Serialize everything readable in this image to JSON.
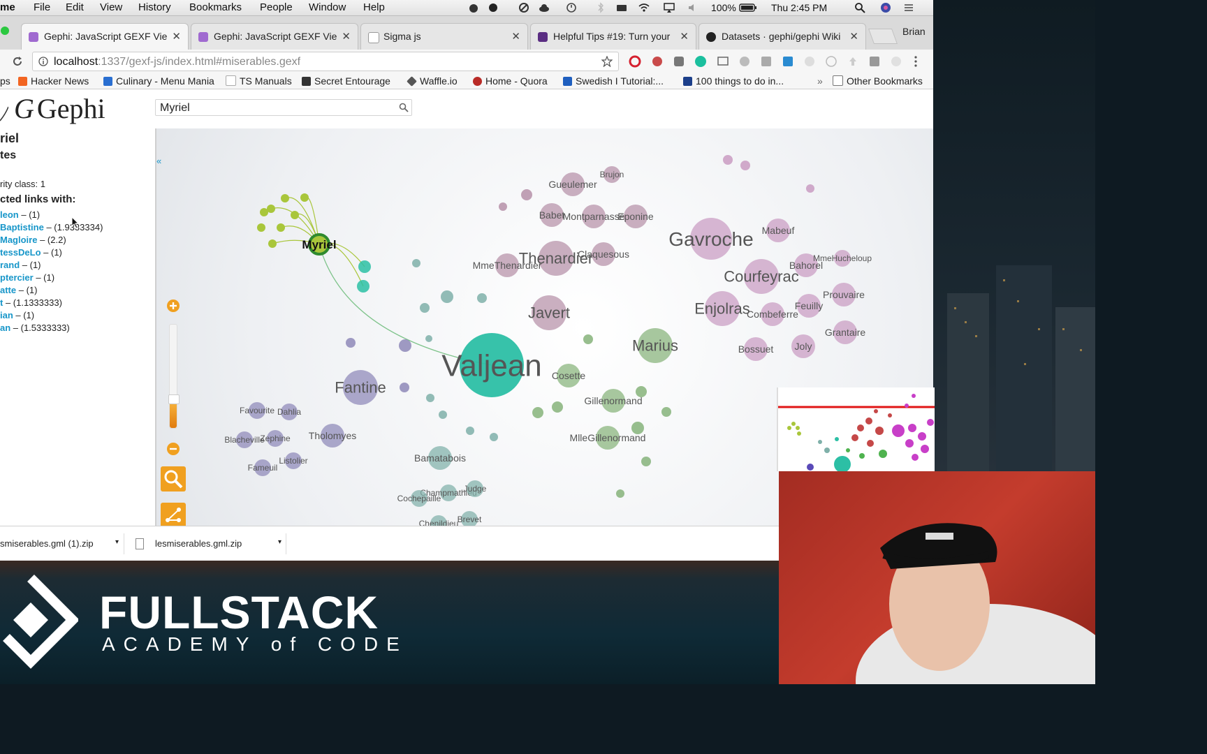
{
  "menubar": {
    "app": "me",
    "items": [
      "File",
      "Edit",
      "View",
      "History",
      "Bookmarks",
      "People",
      "Window",
      "Help"
    ],
    "battery": "100%",
    "clock": "Thu 2:45 PM"
  },
  "tabs": [
    {
      "label": "Gephi: JavaScript GEXF Vie",
      "color": "#a06ad0",
      "active": true
    },
    {
      "label": "Gephi: JavaScript GEXF Vie",
      "color": "#a06ad0",
      "active": false
    },
    {
      "label": "Sigma js",
      "color": "#9a9a9a",
      "active": false
    },
    {
      "label": "Helpful Tips #19: Turn your",
      "color": "#5a2d82",
      "active": false
    },
    {
      "label": "Datasets · gephi/gephi Wiki",
      "color": "#222222",
      "active": false
    }
  ],
  "profile": "Brian",
  "url": {
    "host": "localhost",
    "path": ":1337/gexf-js/index.html#miserables.gexf"
  },
  "bookmarks": [
    {
      "label": "ps",
      "color": "#888888"
    },
    {
      "label": "Hacker News",
      "color": "#f26522"
    },
    {
      "label": "Culinary - Menu Mania",
      "color": "#2a6fd1"
    },
    {
      "label": "TS Manuals",
      "color": "#bbbbbb"
    },
    {
      "label": "Secret Entourage",
      "color": "#333333"
    },
    {
      "label": "Waffle.io",
      "color": "#555555"
    },
    {
      "label": "Home - Quora",
      "color": "#b92b27"
    },
    {
      "label": "Swedish I Tutorial:...",
      "color": "#1f5fbf"
    },
    {
      "label": "100 things to do in...",
      "color": "#1c3f8a"
    }
  ],
  "other_bookmarks": "Other Bookmarks",
  "app": {
    "logo": "Gephi",
    "search_value": "Myriel"
  },
  "panel": {
    "title": "riel",
    "subtitle": "tes",
    "class_line": "rity class: 1",
    "links_heading": "cted links with:",
    "links": [
      {
        "name": "leon",
        "weight": " – (1)"
      },
      {
        "name": "Baptistine",
        "weight": " – (1.9333334)"
      },
      {
        "name": "Magloire",
        "weight": " – (2.2)"
      },
      {
        "name": "tessDeLo",
        "weight": " – (1)"
      },
      {
        "name": "rand",
        "weight": " – (1)"
      },
      {
        "name": "ptercier",
        "weight": " – (1)"
      },
      {
        "name": "atte",
        "weight": " – (1)"
      },
      {
        "name": "t",
        "weight": " – (1.1333333)"
      },
      {
        "name": "ian",
        "weight": " – (1)"
      },
      {
        "name": "an",
        "weight": " – (1.5333333)"
      }
    ]
  },
  "graph": {
    "colors": {
      "teal": "#2cbfa5",
      "purple": "#8e88b8",
      "mauve": "#b690a8",
      "pink": "#c99bc2",
      "green": "#86b37a",
      "lime": "#a9c63b",
      "grey_teal": "#7fb0a9"
    },
    "selected": "Myriel",
    "nodes": [
      {
        "label": "Valjean",
        "size": "xl",
        "group": "teal"
      },
      {
        "label": "Fantine",
        "size": "m",
        "group": "purple"
      },
      {
        "label": "Javert",
        "size": "m",
        "group": "mauve"
      },
      {
        "label": "Marius",
        "size": "m",
        "group": "green"
      },
      {
        "label": "Cosette",
        "size": "s",
        "group": "green"
      },
      {
        "label": "Gavroche",
        "size": "l",
        "group": "pink"
      },
      {
        "label": "Thenardier",
        "size": "m",
        "group": "mauve"
      },
      {
        "label": "MmeThenardier",
        "size": "s",
        "group": "mauve"
      },
      {
        "label": "Enjolras",
        "size": "m",
        "group": "pink"
      },
      {
        "label": "Courfeyrac",
        "size": "m",
        "group": "pink"
      },
      {
        "label": "Bossuet",
        "size": "s",
        "group": "pink"
      },
      {
        "label": "Joly",
        "size": "s",
        "group": "pink"
      },
      {
        "label": "Bahorel",
        "size": "s",
        "group": "pink"
      },
      {
        "label": "Combeferre",
        "size": "s",
        "group": "pink"
      },
      {
        "label": "Feuilly",
        "size": "s",
        "group": "pink"
      },
      {
        "label": "Prouvaire",
        "size": "s",
        "group": "pink"
      },
      {
        "label": "Grantaire",
        "size": "s",
        "group": "pink"
      },
      {
        "label": "Mabeuf",
        "size": "s",
        "group": "pink"
      },
      {
        "label": "MmeHucheloup",
        "size": "xs",
        "group": "pink"
      },
      {
        "label": "Gueulemer",
        "size": "s",
        "group": "mauve"
      },
      {
        "label": "Babet",
        "size": "s",
        "group": "mauve"
      },
      {
        "label": "Montparnasse",
        "size": "s",
        "group": "mauve"
      },
      {
        "label": "Eponine",
        "size": "s",
        "group": "mauve"
      },
      {
        "label": "Claquesous",
        "size": "s",
        "group": "mauve"
      },
      {
        "label": "Brujon",
        "size": "xs",
        "group": "mauve"
      },
      {
        "label": "Gillenormand",
        "size": "s",
        "group": "green"
      },
      {
        "label": "MlleGillenormand",
        "size": "s",
        "group": "green"
      },
      {
        "label": "Tholomyes",
        "size": "s",
        "group": "purple"
      },
      {
        "label": "Favourite",
        "size": "xs",
        "group": "purple"
      },
      {
        "label": "Dahlia",
        "size": "xs",
        "group": "purple"
      },
      {
        "label": "Blacheville",
        "size": "xs",
        "group": "purple"
      },
      {
        "label": "Zephine",
        "size": "xs",
        "group": "purple"
      },
      {
        "label": "Listolier",
        "size": "xs",
        "group": "purple"
      },
      {
        "label": "Fameuil",
        "size": "xs",
        "group": "purple"
      },
      {
        "label": "Bamatabois",
        "size": "s",
        "group": "grey_teal"
      },
      {
        "label": "Champmathieu",
        "size": "xs",
        "group": "grey_teal"
      },
      {
        "label": "Cochepaille",
        "size": "xs",
        "group": "grey_teal"
      },
      {
        "label": "Judge",
        "size": "xs",
        "group": "grey_teal"
      },
      {
        "label": "Chenildieu",
        "size": "xs",
        "group": "grey_teal"
      },
      {
        "label": "Brevet",
        "size": "xs",
        "group": "grey_teal"
      }
    ]
  },
  "downloads": [
    "smiserables.gml (1).zip",
    "lesmiserables.gml.zip"
  ],
  "brand": {
    "name": "FULLSTACK",
    "tagline": "ACADEMY of CODE"
  }
}
